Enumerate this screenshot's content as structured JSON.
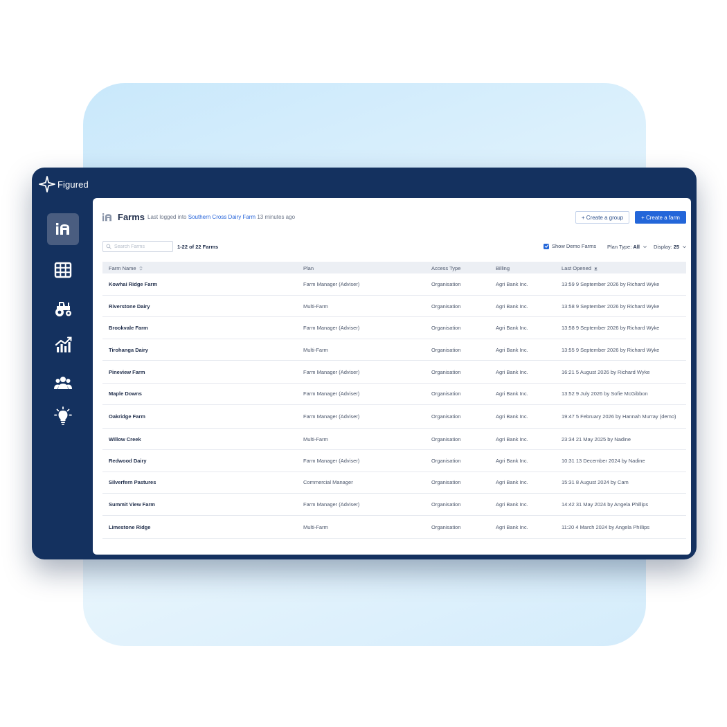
{
  "brand": {
    "name": "Figured"
  },
  "nav": [
    {
      "id": "farms",
      "icon": "farm-admin-icon",
      "active": true
    },
    {
      "id": "grid",
      "icon": "grid-icon",
      "active": false
    },
    {
      "id": "tractor",
      "icon": "tractor-icon",
      "active": false
    },
    {
      "id": "reports",
      "icon": "chart-icon",
      "active": false
    },
    {
      "id": "people",
      "icon": "people-icon",
      "active": false
    },
    {
      "id": "ideas",
      "icon": "lightbulb-icon",
      "active": false
    }
  ],
  "header": {
    "icon_label": "iA",
    "title": "Farms",
    "last_logged_prefix": "Last logged into",
    "last_logged_farm": "Southern Cross Dairy Farm",
    "last_logged_suffix": "13 minutes ago",
    "create_group_label": "+ Create a group",
    "create_farm_label": "+ Create a farm"
  },
  "toolbar": {
    "search_placeholder": "Search Farms",
    "count_label": "1-22 of 22 Farms",
    "show_demo_label": "Show Demo Farms",
    "show_demo_checked": true,
    "plan_type_label": "Plan Type:",
    "plan_type_value": "All",
    "display_label": "Display:",
    "display_value": "25"
  },
  "table": {
    "columns": [
      "Farm Name",
      "Plan",
      "Access Type",
      "Billing",
      "Last Opened"
    ],
    "rows": [
      [
        "Kowhai Ridge Farm",
        "Farm Manager (Adviser)",
        "Organisation",
        "Agri Bank Inc.",
        "13:59 9 September 2026 by Richard Wyke"
      ],
      [
        "Riverstone Dairy",
        "Multi-Farm",
        "Organisation",
        "Agri Bank Inc.",
        "13:58 9 September 2026 by Richard Wyke"
      ],
      [
        "Brookvale Farm",
        "Farm Manager (Adviser)",
        "Organisation",
        "Agri Bank Inc.",
        "13:58 9 September 2026 by Richard Wyke"
      ],
      [
        "Tirohanga Dairy",
        "Multi-Farm",
        "Organisation",
        "Agri Bank Inc.",
        "13:55 9 September 2026 by Richard Wyke"
      ],
      [
        "Pineview Farm",
        "Farm Manager (Adviser)",
        "Organisation",
        "Agri Bank Inc.",
        "16:21 5 August 2026 by Richard Wyke"
      ],
      [
        "Maple Downs",
        "Farm Manager (Adviser)",
        "Organisation",
        "Agri Bank Inc.",
        "13:52 9 July 2026 by Sofie McGibbon"
      ],
      [
        "Oakridge Farm",
        "Farm Manager (Adviser)",
        "Organisation",
        "Agri Bank Inc.",
        "19:47 5 February 2026 by Hannah Murray (demo)"
      ],
      [
        "Willow Creek",
        "Multi-Farm",
        "Organisation",
        "Agri Bank Inc.",
        "23:34 21 May 2025 by Nadine"
      ],
      [
        "Redwood Dairy",
        "Farm Manager (Adviser)",
        "Organisation",
        "Agri Bank Inc.",
        "10:31 13 December 2024 by Nadine"
      ],
      [
        "Silverfern Pastures",
        "Commercial Manager",
        "Organisation",
        "Agri Bank Inc.",
        "15:31 8 August 2024 by Cam"
      ],
      [
        "Summit View Farm",
        "Farm Manager (Adviser)",
        "Organisation",
        "Agri Bank Inc.",
        "14:42 31 May 2024 by Angela Phillips"
      ],
      [
        "Limestone Ridge",
        "Multi-Farm",
        "Organisation",
        "Agri Bank Inc.",
        "11:20 4 March 2024 by Angela Phillips"
      ]
    ]
  },
  "colors": {
    "window": "#14315f",
    "accent": "#2366d9",
    "active_nav": "#4a5d80"
  }
}
